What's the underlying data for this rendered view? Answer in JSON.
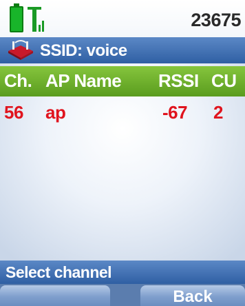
{
  "status_bar": {
    "number": "23675",
    "battery_icon": "battery-full-icon",
    "signal_icon": "signal-strength-icon"
  },
  "header": {
    "icon": "wifi-network-icon",
    "title": "SSID: voice"
  },
  "table": {
    "columns": [
      "Ch.",
      "AP Name",
      "RSSI",
      "CU"
    ],
    "rows": [
      {
        "ch": "56",
        "ap_name": "ap",
        "rssi": "-67",
        "cu": "2"
      }
    ]
  },
  "info": {
    "text": "Select channel"
  },
  "softkeys": {
    "left": "",
    "right": "Back"
  },
  "colors": {
    "header_blue": "#2f5fa3",
    "column_green": "#5a9c1e",
    "row_red": "#e0141e",
    "battery_green": "#18b52a"
  }
}
